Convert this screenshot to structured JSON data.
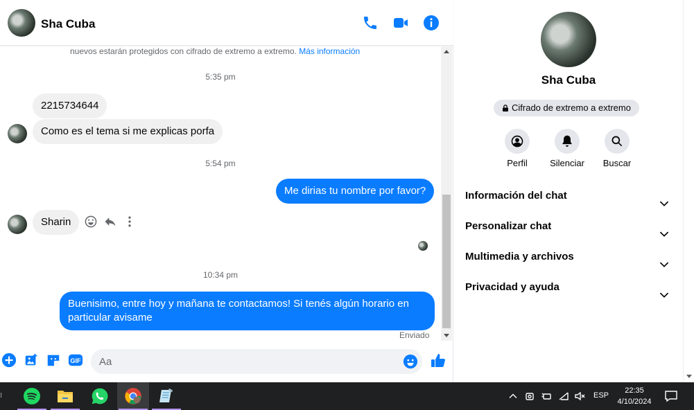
{
  "header": {
    "contact_name": "Sha Cuba",
    "icons": [
      "phone-icon",
      "video-icon",
      "info-icon"
    ]
  },
  "conversation": {
    "encryption_note": "nuevos estarán protegidos con cifrado de extremo a extremo.",
    "encryption_link": "Más información",
    "timestamps": [
      "5:35 pm",
      "5:54 pm",
      "10:34 pm"
    ],
    "messages": [
      {
        "from": "them",
        "text": "2215734644"
      },
      {
        "from": "them",
        "text": "Como es el tema si me explicas porfa"
      },
      {
        "from": "me",
        "text": "Me dirias tu nombre por favor?"
      },
      {
        "from": "them",
        "text": "Sharin"
      },
      {
        "from": "me",
        "text": "Buenisimo, entre hoy y mañana te contactamos! Si tenés algún horario en particular avisame"
      }
    ],
    "delivery_status": "Enviado"
  },
  "composer": {
    "placeholder": "Aa",
    "value": "",
    "gif_label": "GIF"
  },
  "info_panel": {
    "name": "Sha Cuba",
    "encryption_badge": "Cifrado de extremo a extremo",
    "actions": [
      {
        "label": "Perfil",
        "icon": "profile-icon"
      },
      {
        "label": "Silenciar",
        "icon": "bell-icon"
      },
      {
        "label": "Buscar",
        "icon": "search-icon"
      }
    ],
    "sections": [
      "Información del chat",
      "Personalizar chat",
      "Multimedia y archivos",
      "Privacidad y ayuda"
    ]
  },
  "taskbar": {
    "apps": [
      "spotify-icon",
      "file-explorer-icon",
      "whatsapp-icon",
      "chrome-icon",
      "notepad-icon"
    ],
    "language": "ESP",
    "time": "22:35",
    "date": "4/10/2024"
  },
  "colors": {
    "accent": "#0a7cff",
    "incoming_bubble": "#f0f0f0",
    "taskbar": "#1f2021"
  }
}
